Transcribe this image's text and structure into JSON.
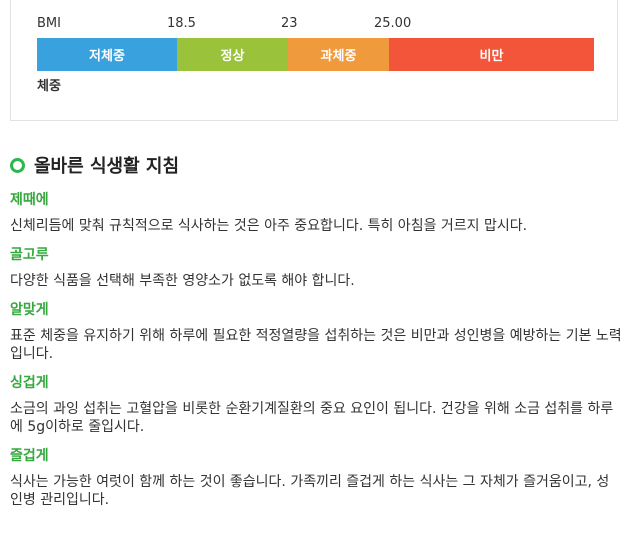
{
  "bmi": {
    "scale_labels": [
      "BMI",
      "18.5",
      "23",
      "25.00"
    ],
    "segments": [
      {
        "label": "저체중",
        "color": "#3aa1df"
      },
      {
        "label": "정상",
        "color": "#9ac23b"
      },
      {
        "label": "과체중",
        "color": "#f09a3e"
      },
      {
        "label": "비만",
        "color": "#f2553a"
      }
    ],
    "row_label": "체중"
  },
  "section": {
    "title": "올바른 식생활 지침",
    "accent_color": "#2db84b"
  },
  "guides": [
    {
      "title": "제때에",
      "text": "신체리듬에 맞춰 규칙적으로 식사하는 것은 아주 중요합니다. 특히 아침을 거르지 맙시다."
    },
    {
      "title": "골고루",
      "text": "다양한 식품을 선택해 부족한 영양소가 없도록 해야 합니다."
    },
    {
      "title": "알맞게",
      "text": "표준 체중을 유지하기 위해 하루에 필요한 적정열량을 섭취하는 것은 비만과 성인병을 예방하는 기본 노력입니다."
    },
    {
      "title": "싱겁게",
      "text": "소금의 과잉 섭취는 고혈압을 비롯한 순환기계질환의 중요 요인이 됩니다. 건강을 위해 소금 섭취를 하루에 5g이하로 줄입시다."
    },
    {
      "title": "즐겁게",
      "text": "식사는 가능한 여럿이 함께 하는 것이 좋습니다. 가족끼리 즐겁게 하는 식사는 그 자체가 즐거움이고, 성인병 관리입니다."
    }
  ]
}
